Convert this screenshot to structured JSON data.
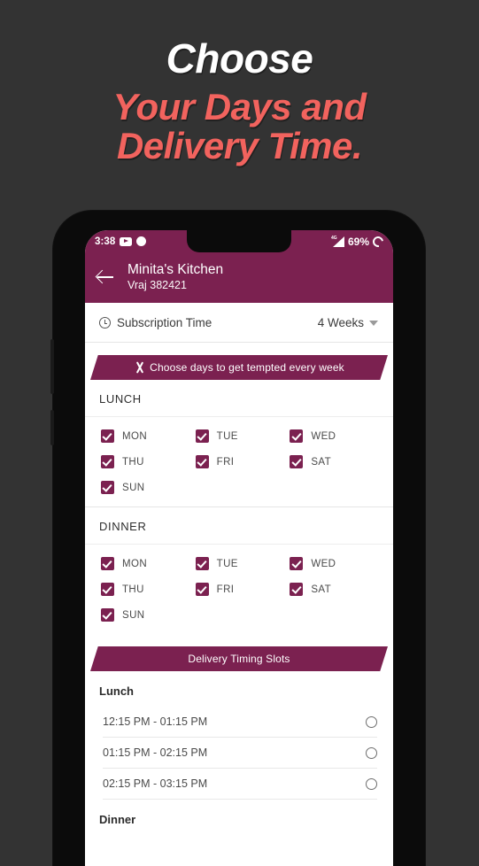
{
  "promo": {
    "line1": "Choose",
    "line2": "Your Days and",
    "line3": "Delivery Time.",
    "white": "#FFFFFF",
    "coral": "#F2635E",
    "background": "#333333"
  },
  "theme": {
    "brand_purple": "#7B2150",
    "screen_background": "#FFFFFF"
  },
  "statusbar": {
    "time": "3:38",
    "youtube_icon": "youtube-icon",
    "notification_dot": "notification-dot-icon",
    "network": "4G",
    "signal_icon": "signal-icon",
    "battery_percent": "69%",
    "battery_icon": "battery-ring-icon"
  },
  "appbar": {
    "back_icon": "back-arrow-icon",
    "shop_name": "Minita's Kitchen",
    "shop_address": "Vraj 382421"
  },
  "subscription": {
    "clock_icon": "clock-icon",
    "label": "Subscription Time",
    "value": "4 Weeks",
    "caret_icon": "chevron-down-icon"
  },
  "days_banner": {
    "icon": "cutlery-icon",
    "text": "Choose days to get tempted every week"
  },
  "meals": [
    {
      "title": "LUNCH",
      "days": [
        {
          "label": "MON",
          "checked": true
        },
        {
          "label": "TUE",
          "checked": true
        },
        {
          "label": "WED",
          "checked": true
        },
        {
          "label": "THU",
          "checked": true
        },
        {
          "label": "FRI",
          "checked": true
        },
        {
          "label": "SAT",
          "checked": true
        },
        {
          "label": "SUN",
          "checked": true
        }
      ]
    },
    {
      "title": "DINNER",
      "days": [
        {
          "label": "MON",
          "checked": true
        },
        {
          "label": "TUE",
          "checked": true
        },
        {
          "label": "WED",
          "checked": true
        },
        {
          "label": "THU",
          "checked": true
        },
        {
          "label": "FRI",
          "checked": true
        },
        {
          "label": "SAT",
          "checked": true
        },
        {
          "label": "SUN",
          "checked": true
        }
      ]
    }
  ],
  "timing_banner": {
    "text": "Delivery Timing Slots"
  },
  "timing": {
    "lunch_heading": "Lunch",
    "lunch_slots": [
      {
        "time": "12:15 PM - 01:15 PM",
        "selected": false
      },
      {
        "time": "01:15 PM - 02:15 PM",
        "selected": false
      },
      {
        "time": "02:15 PM - 03:15 PM",
        "selected": false
      }
    ],
    "dinner_heading": "Dinner"
  }
}
